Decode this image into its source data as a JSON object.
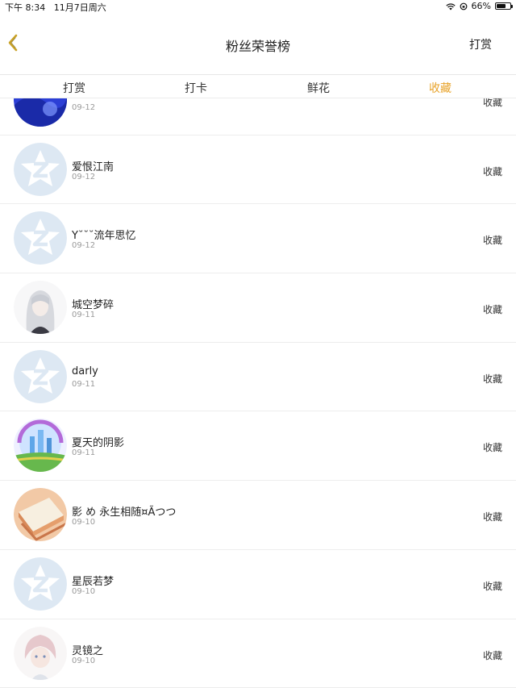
{
  "status_bar": {
    "time": "下午 8:34",
    "date": "11月7日周六",
    "battery": "66%",
    "battery_level": 0.66
  },
  "nav": {
    "title": "粉丝荣誉榜",
    "action_label": "打赏"
  },
  "tabs": [
    {
      "label": "打赏",
      "active": false
    },
    {
      "label": "打卡",
      "active": false
    },
    {
      "label": "鲜花",
      "active": false
    },
    {
      "label": "收藏",
      "active": true
    }
  ],
  "list": {
    "rows": [
      {
        "name": "",
        "date": "09-12",
        "action": "收藏",
        "avatar": "blue-anime"
      },
      {
        "name": "爱恨江南",
        "date": "09-12",
        "action": "收藏",
        "avatar": "default-star"
      },
      {
        "name": "Y˘˘˘流年思忆",
        "date": "09-12",
        "action": "收藏",
        "avatar": "default-star"
      },
      {
        "name": "城空梦碎",
        "date": "09-11",
        "action": "收藏",
        "avatar": "anime-girl"
      },
      {
        "name": "darly",
        "date": "09-11",
        "action": "收藏",
        "avatar": "default-star"
      },
      {
        "name": "夏天的阴影",
        "date": "09-11",
        "action": "收藏",
        "avatar": "castle"
      },
      {
        "name": "影 め 永生相随¤Ãつつ",
        "date": "09-10",
        "action": "收藏",
        "avatar": "books"
      },
      {
        "name": "星辰若梦",
        "date": "09-10",
        "action": "收藏",
        "avatar": "default-star"
      },
      {
        "name": "灵镜之",
        "date": "09-10",
        "action": "收藏",
        "avatar": "anime-boy"
      }
    ]
  },
  "colors": {
    "accent": "#e8a32a",
    "divider": "#ededed",
    "default_avatar_bg": "#dde8f3"
  }
}
